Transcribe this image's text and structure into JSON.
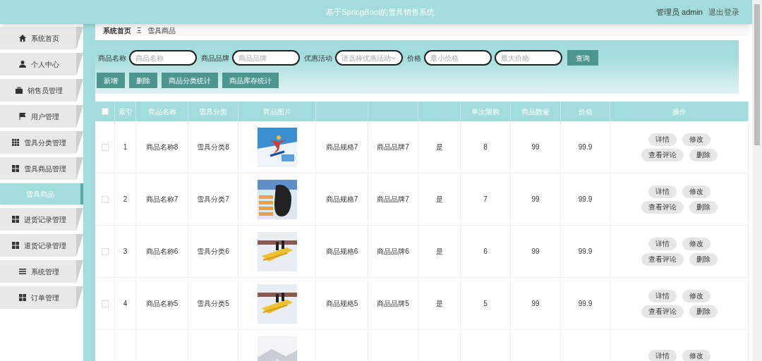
{
  "header": {
    "title": "基于SpringBoot的雪具销售系统",
    "user": "管理员 admin",
    "logout": "退出登录"
  },
  "sidebar": {
    "items": [
      {
        "label": "系统首页",
        "selected": false
      },
      {
        "label": "个人中心",
        "selected": false
      },
      {
        "label": "销售员管理",
        "selected": false
      },
      {
        "label": "用户管理",
        "selected": false
      },
      {
        "label": "雪具分类管理",
        "selected": false
      },
      {
        "label": "雪具商品管理",
        "selected": false
      },
      {
        "label": "雪具商品",
        "selected": true
      },
      {
        "label": "进货记录管理",
        "selected": false
      },
      {
        "label": "退货记录管理",
        "selected": false
      },
      {
        "label": "系统管理",
        "selected": false
      },
      {
        "label": "订单管理",
        "selected": false
      }
    ]
  },
  "breadcrumb": {
    "items": [
      "系统首页",
      "雪具商品"
    ],
    "separator": "Ξ"
  },
  "search": {
    "fields": [
      {
        "label": "商品名称",
        "placeholder": "商品名称",
        "kind": "text"
      },
      {
        "label": "商品品牌",
        "placeholder": "商品品牌",
        "kind": "text"
      },
      {
        "label": "优惠活动",
        "placeholder": "请选择优惠活动",
        "kind": "select"
      },
      {
        "label": "价格",
        "placeholder": "最小价格",
        "kind": "text"
      },
      {
        "placeholder": "最大价格",
        "kind": "text"
      }
    ],
    "button": "查询"
  },
  "actions": [
    "新增",
    "删除",
    "商品分类统计",
    "商品库存统计"
  ],
  "table": {
    "columns": [
      {
        "kind": "check",
        "checked": false
      },
      {
        "label": "索引"
      },
      {
        "label": "商品名称"
      },
      {
        "label": "雪具分类"
      },
      {
        "label": "商品图片"
      },
      {},
      {},
      {},
      {
        "label": "单次限购"
      },
      {
        "label": "商品数量"
      },
      {
        "label": "价格"
      },
      {
        "label": "操作"
      }
    ],
    "rows": [
      {
        "checked": false,
        "cells": [
          "1",
          "商品名称8",
          "雪具分类8",
          "",
          "商品规格7",
          "商品品牌7",
          "是",
          "8",
          "99",
          "99.9"
        ],
        "buttons": [
          "详情",
          "修改",
          "查看评论",
          "删除"
        ]
      },
      {
        "checked": false,
        "cells": [
          "2",
          "商品名称7",
          "雪具分类7",
          "",
          "商品规格7",
          "商品品牌7",
          "是",
          "7",
          "99",
          "99.9"
        ],
        "buttons": [
          "详情",
          "修改",
          "查看评论",
          "删除"
        ]
      },
      {
        "checked": false,
        "cells": [
          "3",
          "商品名称6",
          "雪具分类6",
          "",
          "商品规格6",
          "商品品牌6",
          "是",
          "6",
          "99",
          "99.9"
        ],
        "buttons": [
          "详情",
          "修改",
          "查看评论",
          "删除"
        ]
      },
      {
        "checked": false,
        "cells": [
          "4",
          "商品名称5",
          "雪具分类5",
          "",
          "商品规格5",
          "商品品牌5",
          "是",
          "5",
          "99",
          "99.9"
        ],
        "buttons": [
          "详情",
          "修改",
          "查看评论",
          "删除"
        ]
      },
      {
        "buttons": [
          "详情",
          "修改"
        ]
      }
    ]
  }
}
